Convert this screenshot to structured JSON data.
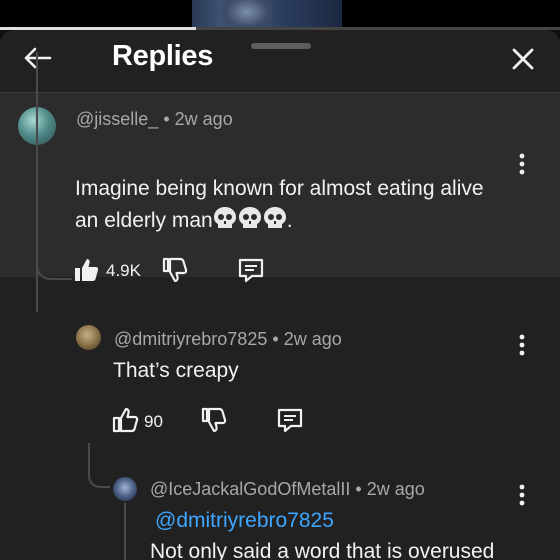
{
  "header": {
    "title": "Replies",
    "back_icon": "arrow-left-icon",
    "close_icon": "close-icon"
  },
  "video": {
    "progress_fraction": 0.35
  },
  "comments": [
    {
      "handle": "@jisselle_",
      "time": "2w ago",
      "text_line1": "Imagine being known for almost eating alive",
      "text_line2": "an elderly man",
      "text_suffix": ".",
      "emoji": [
        "skull-emoji",
        "skull-emoji",
        "skull-emoji"
      ],
      "likes": "4.9K",
      "liked": true
    },
    {
      "handle": "@dmitriyrebro7825",
      "time": "2w ago",
      "text_line1": "That’s creapy",
      "likes": "90",
      "liked": false
    },
    {
      "handle": "@IceJackalGodOfMetalII",
      "time": "2w ago",
      "mention": "@dmitriyrebro7825",
      "text_line1": "Not only said a word that is overused"
    }
  ],
  "separator": "•"
}
